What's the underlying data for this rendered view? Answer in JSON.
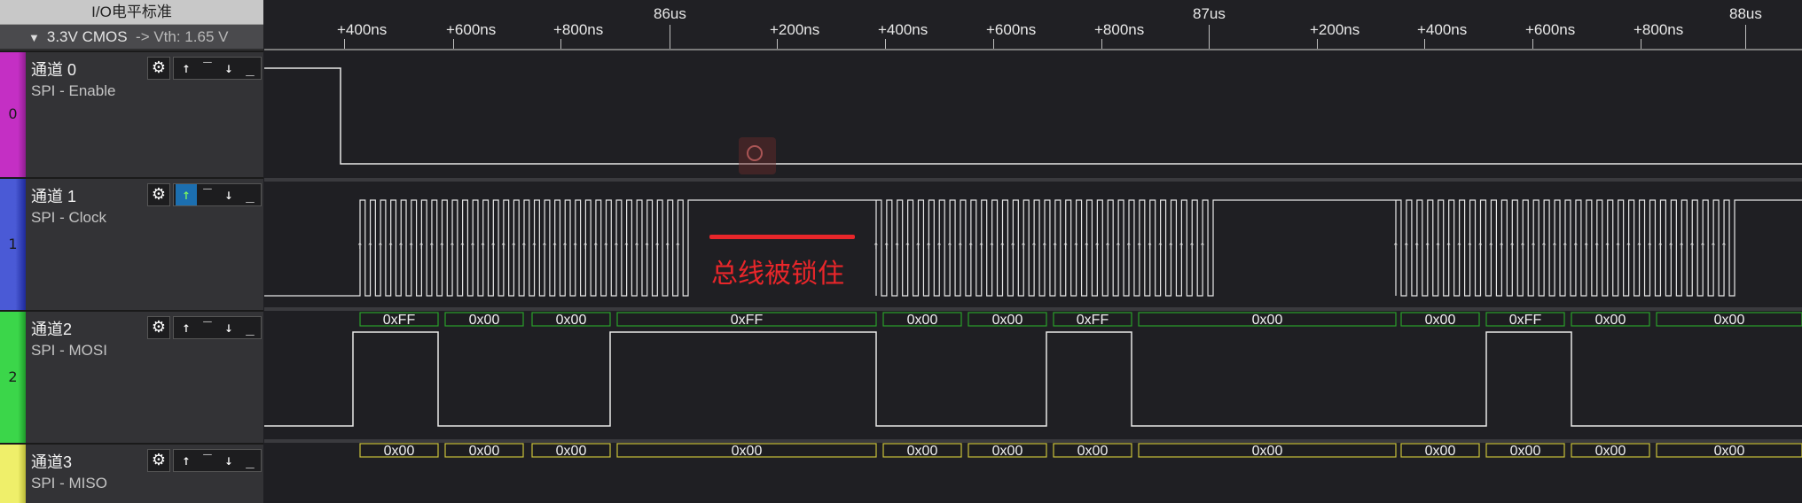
{
  "io_header": "I/O电平标准",
  "io_mode": {
    "standard": "3.3V CMOS",
    "vth": "-> Vth: 1.65 V"
  },
  "timeline": {
    "ticks": [
      {
        "label": "+400ns",
        "kind": "minor"
      },
      {
        "label": "+600ns",
        "kind": "minor"
      },
      {
        "label": "+800ns",
        "kind": "minor"
      },
      {
        "label": "86us",
        "kind": "major"
      },
      {
        "label": "+200ns",
        "kind": "minor"
      },
      {
        "label": "+400ns",
        "kind": "minor"
      },
      {
        "label": "+600ns",
        "kind": "minor"
      },
      {
        "label": "+800ns",
        "kind": "minor"
      },
      {
        "label": "87us",
        "kind": "major"
      },
      {
        "label": "+200ns",
        "kind": "minor"
      },
      {
        "label": "+400ns",
        "kind": "minor"
      },
      {
        "label": "+600ns",
        "kind": "minor"
      },
      {
        "label": "+800ns",
        "kind": "minor"
      },
      {
        "label": "88us",
        "kind": "major"
      }
    ]
  },
  "channels": [
    {
      "name": "通道 0",
      "protocol": "SPI - Enable",
      "index": "0",
      "color": "#c42fc4",
      "trigger_active": false
    },
    {
      "name": "通道 1",
      "protocol": "SPI - Clock",
      "index": "1",
      "color": "#3a49c8",
      "trigger_active": true
    },
    {
      "name": "通道2",
      "protocol": "SPI - MOSI",
      "index": "2",
      "color": "#3bd64a",
      "trigger_active": false
    },
    {
      "name": "通道3",
      "protocol": "SPI - MISO",
      "index": "3",
      "color": "#ecec5a",
      "trigger_active": false
    }
  ],
  "icons": {
    "settings": "gear-icon",
    "rising": "rising-edge-icon",
    "high": "high-level-icon",
    "falling": "falling-edge-icon",
    "low": "low-level-icon"
  },
  "mosi_bytes": [
    "0xFF",
    "0x00",
    "0x00",
    "0xFF",
    "0x00",
    "0x00",
    "0xFF",
    "0x00",
    "0x00",
    "0xFF",
    "0x00",
    "0x00"
  ],
  "miso_bytes": [
    "0x00",
    "0x00",
    "0x00",
    "0x00",
    "0x00",
    "0x00",
    "0x00",
    "0x00",
    "0x00",
    "0x00",
    "0x00",
    "0x00"
  ],
  "annotation": "总线被锁住",
  "colors": {
    "decode_mosi": "#2aa02a",
    "decode_miso": "#c9c03a",
    "annotation": "#e8262a",
    "waveform": "#e8e8e8"
  }
}
